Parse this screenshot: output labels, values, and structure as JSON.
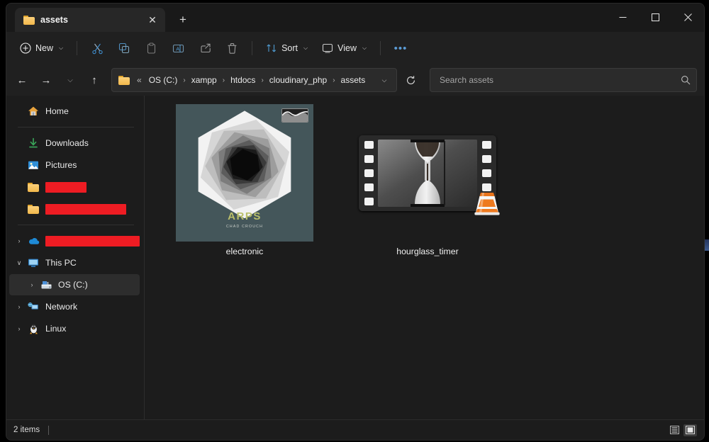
{
  "window": {
    "title": "assets",
    "controls": {
      "minimize": "–",
      "maximize": "□",
      "close": "✕"
    }
  },
  "tabs": {
    "items": [
      {
        "label": "assets",
        "icon": "folder-icon",
        "close": "✕"
      }
    ],
    "new_tab": "+"
  },
  "toolbar": {
    "new_label": "New",
    "sort_label": "Sort",
    "view_label": "View",
    "more_label": "•••",
    "chevron": "⌵",
    "icons": [
      "cut-icon",
      "copy-icon",
      "paste-icon",
      "rename-icon",
      "share-icon",
      "delete-icon"
    ]
  },
  "address": {
    "back": "←",
    "forward": "→",
    "recent": "⌵",
    "up": "↑",
    "overflow": "«",
    "separator": "›",
    "crumbs": [
      "OS (C:)",
      "xampp",
      "htdocs",
      "cloudinary_php",
      "assets"
    ],
    "dropdown": "⌵",
    "refresh": "↻"
  },
  "search": {
    "placeholder": "Search assets",
    "value": "",
    "icon": "search-icon"
  },
  "sidebar": {
    "groups": [
      {
        "items": [
          {
            "label": "Home",
            "icon": "home-icon",
            "twisty": "",
            "selected": false,
            "redacted": false
          }
        ]
      },
      {
        "items": [
          {
            "label": "Downloads",
            "icon": "downloads-icon",
            "twisty": "",
            "selected": false,
            "redacted": false
          },
          {
            "label": "Pictures",
            "icon": "pictures-icon",
            "twisty": "",
            "selected": false,
            "redacted": false
          },
          {
            "label": "",
            "icon": "folder-icon",
            "twisty": "",
            "selected": false,
            "redacted": true,
            "redact_width": 58
          },
          {
            "label": "",
            "icon": "folder-icon",
            "twisty": "",
            "selected": false,
            "redacted": true,
            "redact_width": 114
          }
        ]
      },
      {
        "items": [
          {
            "label": "",
            "icon": "onedrive-icon",
            "twisty": "›",
            "selected": false,
            "redacted": true,
            "redact_width": 142
          },
          {
            "label": "This PC",
            "icon": "thispc-icon",
            "twisty": "∨",
            "selected": false,
            "redacted": false
          },
          {
            "label": "OS (C:)",
            "icon": "drive-icon",
            "twisty": "›",
            "selected": true,
            "redacted": false,
            "indent": true
          },
          {
            "label": "Network",
            "icon": "network-icon",
            "twisty": "›",
            "selected": false,
            "redacted": false
          },
          {
            "label": "Linux",
            "icon": "linux-icon",
            "twisty": "›",
            "selected": false,
            "redacted": false
          }
        ]
      }
    ]
  },
  "files": [
    {
      "name": "electronic",
      "kind": "audio",
      "thumbnail": {
        "album_title": "ARPS",
        "album_artist": "CHAD CROUCH",
        "background_color": "#44565a",
        "title_color": "#b9bf6a",
        "badge": "waveform-badge"
      }
    },
    {
      "name": "hourglass_timer",
      "kind": "video",
      "thumbnail": {
        "frame": "hourglass-video-frame",
        "overlay_icon": "vlc-icon"
      }
    }
  ],
  "statusbar": {
    "item_count": "2 items",
    "views": [
      {
        "name": "details-view",
        "selected": false
      },
      {
        "name": "large-icons-view",
        "selected": true
      }
    ]
  }
}
